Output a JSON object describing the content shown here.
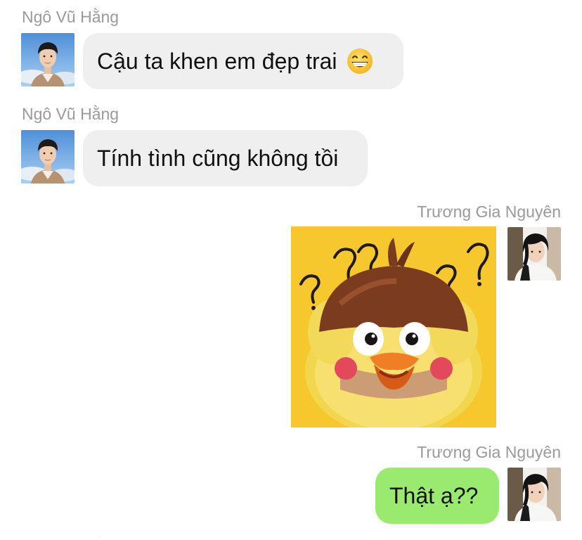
{
  "messages": [
    {
      "sender": "Ngô Vũ Hằng",
      "text": "Cậu ta khen em đẹp trai",
      "emoji": "grinning-face-icon"
    },
    {
      "sender": "Ngô Vũ Hằng",
      "text": "Tính tình cũng không tồi"
    },
    {
      "sender": "Trương Gia Nguyên",
      "sticker": "confused-chick-sticker"
    },
    {
      "sender": "Trương Gia Nguyên",
      "text": "Thật ạ??"
    }
  ],
  "colors": {
    "incoming_bubble": "#efefef",
    "outgoing_bubble": "#99ea6e",
    "sender_name": "#9a9a9a",
    "sticker_background": "#f7c82e"
  }
}
